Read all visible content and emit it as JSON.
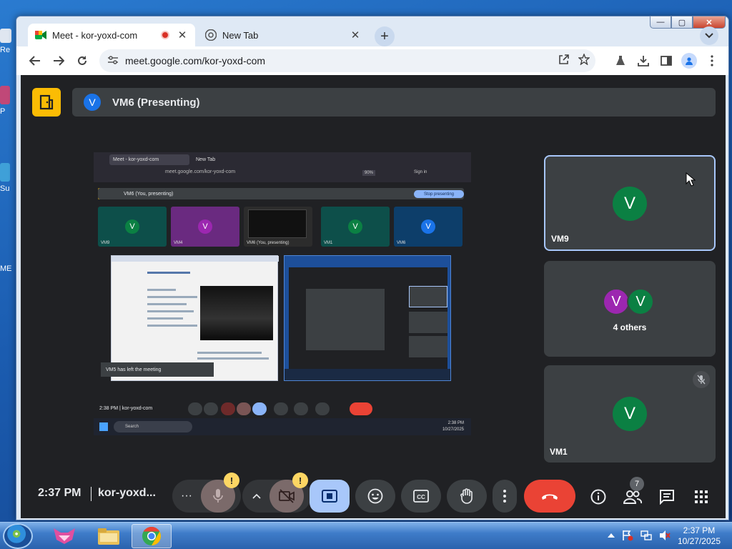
{
  "desktop": {
    "icons": [
      {
        "label": "Re",
        "color": "#e8eef8"
      },
      {
        "label": "P",
        "color": "#c04878"
      },
      {
        "label": "Su",
        "color": "#3fa0d8"
      },
      {
        "label": "ME",
        "color": "#4469a8"
      }
    ]
  },
  "browser": {
    "tabs": [
      {
        "title": "Meet - kor-yoxd-com",
        "close": "✕"
      },
      {
        "title": "New Tab",
        "close": "✕"
      }
    ],
    "new_tab_label": "+",
    "tab_search_label": "⌄",
    "url": "meet.google.com/kor-yoxd-com",
    "window_controls": {
      "minimize": "—",
      "maximize": "▢",
      "close": "✕"
    }
  },
  "meet": {
    "presenter": {
      "initial": "V",
      "label": "VM6 (Presenting)"
    },
    "participants": [
      {
        "name": "VM9",
        "initial": "V",
        "color": "#0b8043",
        "active": true
      },
      {
        "name": "4 others",
        "initials": [
          {
            "initial": "V",
            "color": "#9c27b0"
          },
          {
            "initial": "V",
            "color": "#0b8043"
          }
        ]
      },
      {
        "name": "VM1",
        "initial": "V",
        "color": "#0b8043",
        "muted": true
      }
    ],
    "controls": {
      "time": "2:37 PM",
      "meeting_code": "kor-yoxd...",
      "more_label": "···",
      "mic_warning": "!",
      "camera_warning": "!",
      "people_count": "7"
    },
    "shared_screen": {
      "tab_active": "Meet - kor-yoxd-com",
      "tab_new": "New Tab",
      "url": "meet.google.com/kor-yoxd-com",
      "zoom": "90%",
      "sign_in": "Sign in",
      "presenting_label": "VM6 (You, presenting)",
      "stop_label": "Stop presenting",
      "tiles": [
        {
          "name": "VM9",
          "initial": "V",
          "bg": "#0d4f4a",
          "avatar": "#0b8043"
        },
        {
          "name": "VM4",
          "initial": "V",
          "bg": "#6a2a80",
          "avatar": "#9c27b0"
        },
        {
          "name": "VM6 (You, presenting)",
          "initial": "",
          "bg": "#2c2c2c",
          "avatar": "#2c2c2c"
        },
        {
          "name": "VM1",
          "initial": "V",
          "bg": "#0d4f4a",
          "avatar": "#0b8043"
        },
        {
          "name": "VM6",
          "initial": "V",
          "bg": "#0d3e6a",
          "avatar": "#1a73e8"
        }
      ],
      "toast": "VM5 has left the meeting",
      "time": "2:38 PM",
      "code": "kor-yoxd-com",
      "taskbar_search": "Search",
      "taskbar_time": "2:38 PM",
      "taskbar_date": "10/27/2025"
    }
  },
  "taskbar": {
    "time": "2:37 PM",
    "date": "10/27/2025"
  },
  "colors": {
    "meet_bg": "#202124",
    "tile_bg": "#3c4043",
    "end_call": "#ea4335",
    "present_active": "#a8c7fa",
    "brand": "#fbbc04"
  }
}
